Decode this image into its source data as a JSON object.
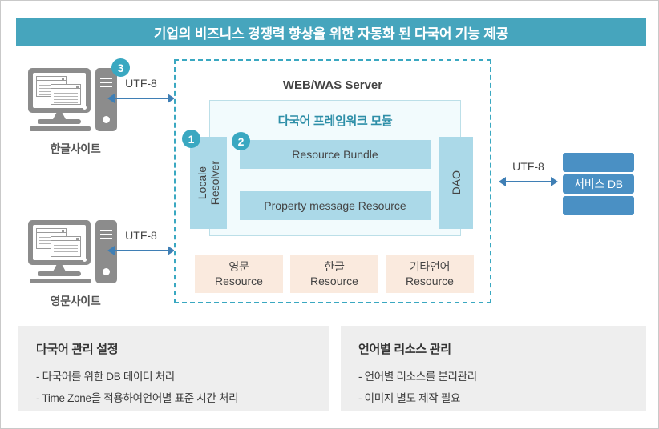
{
  "header": {
    "title": "기업의 비즈니스 경쟁력 향상을 위한 자동화 된 다국어 기능 제공"
  },
  "clients": [
    {
      "label": "한글사이트",
      "badge": "3",
      "icon": "desktop-computer-icon"
    },
    {
      "label": "영문사이트",
      "badge": "",
      "icon": "desktop-computer-icon"
    }
  ],
  "arrows": {
    "client_top": "UTF-8",
    "client_bottom": "UTF-8",
    "db": "UTF-8"
  },
  "server": {
    "title": "WEB/WAS Server",
    "framework_title": "다국어 프레임워크 모듈",
    "locale_resolver": {
      "label": "Locale\nResolver",
      "line1": "Locale",
      "line2": "Resolver",
      "badge": "1"
    },
    "resource_bundle": {
      "label": "Resource Bundle",
      "badge": "2"
    },
    "property_resource": {
      "label": "Property message Resource"
    },
    "dao": {
      "label": "DAO"
    },
    "language_resources": [
      {
        "line1": "영문",
        "line2": "Resource"
      },
      {
        "line1": "한글",
        "line2": "Resource"
      },
      {
        "line1": "기타언어",
        "line2": "Resource"
      }
    ]
  },
  "database": {
    "label": "서비스 DB"
  },
  "panels": [
    {
      "title": "다국어 관리 설정",
      "items": [
        "- 다국어를 위한 DB 데이터 처리",
        "- Time Zone을 적용하여언어별 표준 시간 처리"
      ]
    },
    {
      "title": "언어별 리소스 관리",
      "items": [
        "- 언어별 리소스를 분리관리",
        "- 이미지 별도 제작 필요"
      ]
    }
  ],
  "colors": {
    "header_bg": "#46a5bd",
    "accent_teal": "#3aa8c1",
    "inner_box": "#abd9e8",
    "framework_bg": "#f2fbfd",
    "lang_resource_bg": "#faeade",
    "db_bar": "#4a90c4",
    "arrow": "#3f7fb5",
    "panel_bg": "#eeeeee"
  }
}
